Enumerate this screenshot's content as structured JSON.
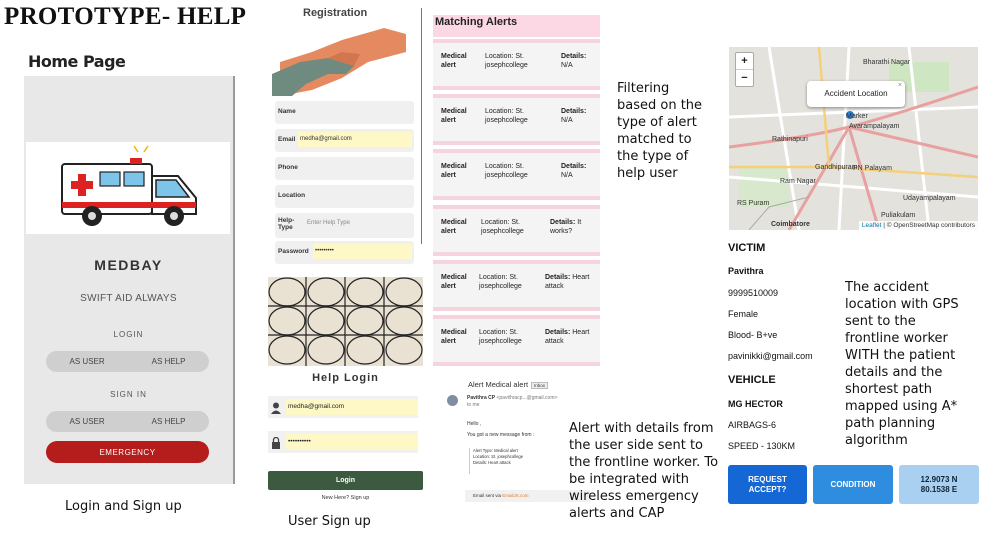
{
  "title": "PROTOTYPE- HELP",
  "home": {
    "heading": "Home Page",
    "app_name": "MEDBAY",
    "tagline": "SWIFT AID ALWAYS",
    "login_label": "LOGIN",
    "signin_label": "SIGN IN",
    "as_user": "AS USER",
    "as_help": "AS HELP",
    "emergency": "EMERGENCY",
    "caption": "Login and Sign up"
  },
  "registration": {
    "title": "Registration",
    "fields": {
      "name": "Name",
      "email": "Email",
      "email_value": "medha@gmail.com",
      "phone": "Phone",
      "location": "Location",
      "help_type": "Help-Type",
      "help_type_placeholder": "Enter Help Type",
      "password": "Password",
      "password_value": "•••••••••"
    }
  },
  "help_login": {
    "title": "Help Login",
    "email_value": "medha@gmail.com",
    "password_value": "••••••••••",
    "login_button": "Login",
    "new_here": "New Here? Sign up",
    "caption": "User Sign up"
  },
  "matching": {
    "title": "Matching Alerts",
    "alerts": [
      {
        "type": "Medical alert",
        "location": "Location: St. josephcollege",
        "details_label": "Details:",
        "details": "N/A"
      },
      {
        "type": "Medical alert",
        "location": "Location: St. josephcollege",
        "details_label": "Details:",
        "details": "N/A"
      },
      {
        "type": "Medical alert",
        "location": "Location: St. josephcollege",
        "details_label": "Details:",
        "details": "N/A"
      },
      {
        "type": "Medical alert",
        "location": "Location: St. josephcollege",
        "details_label": "Details:",
        "details": "It works?"
      },
      {
        "type": "Medical alert",
        "location": "Location: St. josephcollege",
        "details_label": "Details:",
        "details": "Heart attack"
      },
      {
        "type": "Medical alert",
        "location": "Location: St. josephcollege",
        "details_label": "Details:",
        "details": "Heart attack"
      }
    ],
    "caption": "Filtering based on the type of alert matched to the type of help user"
  },
  "email": {
    "subject": "Alert Medical alert",
    "badge": "Inbox",
    "sender": "Pavithra CP",
    "sender_addr": "<pavithracp...@gmail.com>",
    "to": "to me",
    "greeting": "Hello ,",
    "intro": "You got a new message from :",
    "alert_type": "Alert Type: Medical alert",
    "location": "Location: St. josephcollege",
    "details": "Details: Heart attack",
    "footer_label": "Email sent via",
    "footer_link": "EmailJS.com",
    "caption": "Alert with details from the user side sent to the frontline worker. To be integrated with wireless emergency alerts and CAP"
  },
  "map": {
    "zoom_in": "+",
    "zoom_out": "−",
    "popup": "Accident Location",
    "close": "×",
    "marker": "Marker",
    "places": [
      "Bharathi Nagar",
      "Avarampalayam",
      "Rathinapuri",
      "Gandhipuram",
      "PN Palayam",
      "Ram Nagar",
      "Udayampalayam",
      "RS Puram",
      "Puliakulam",
      "Coimbatore"
    ],
    "attribution_leaflet": "Leaflet",
    "attribution_rest": " | © OpenStreetMap contributors"
  },
  "victim": {
    "heading": "VICTIM",
    "name": "Pavithra",
    "phone": "9999510009",
    "gender": "Female",
    "blood": "Blood- B+ve",
    "email": "pavinikki@gmail.com",
    "vehicle_heading": "VEHICLE",
    "vehicle": "MG HECTOR",
    "airbags": "AIRBAGS-6",
    "speed": "SPEED - 130KM",
    "caption": "The accident location with GPS sent to the frontline worker WITH the patient details and the shortest path mapped using A* path planning algorithm"
  },
  "buttons": {
    "request": "REQUEST ACCEPT?",
    "condition": "CONDITION",
    "coords": "12.9073 N 80.1538 E"
  },
  "colors": {
    "emergency_red": "#b51c1c",
    "login_green": "#3c5a3f",
    "request_blue": "#1467d4",
    "condition_blue": "#2f8de0",
    "coords_blue": "#a9d0f0",
    "alert_pink": "#fbd8e3"
  }
}
